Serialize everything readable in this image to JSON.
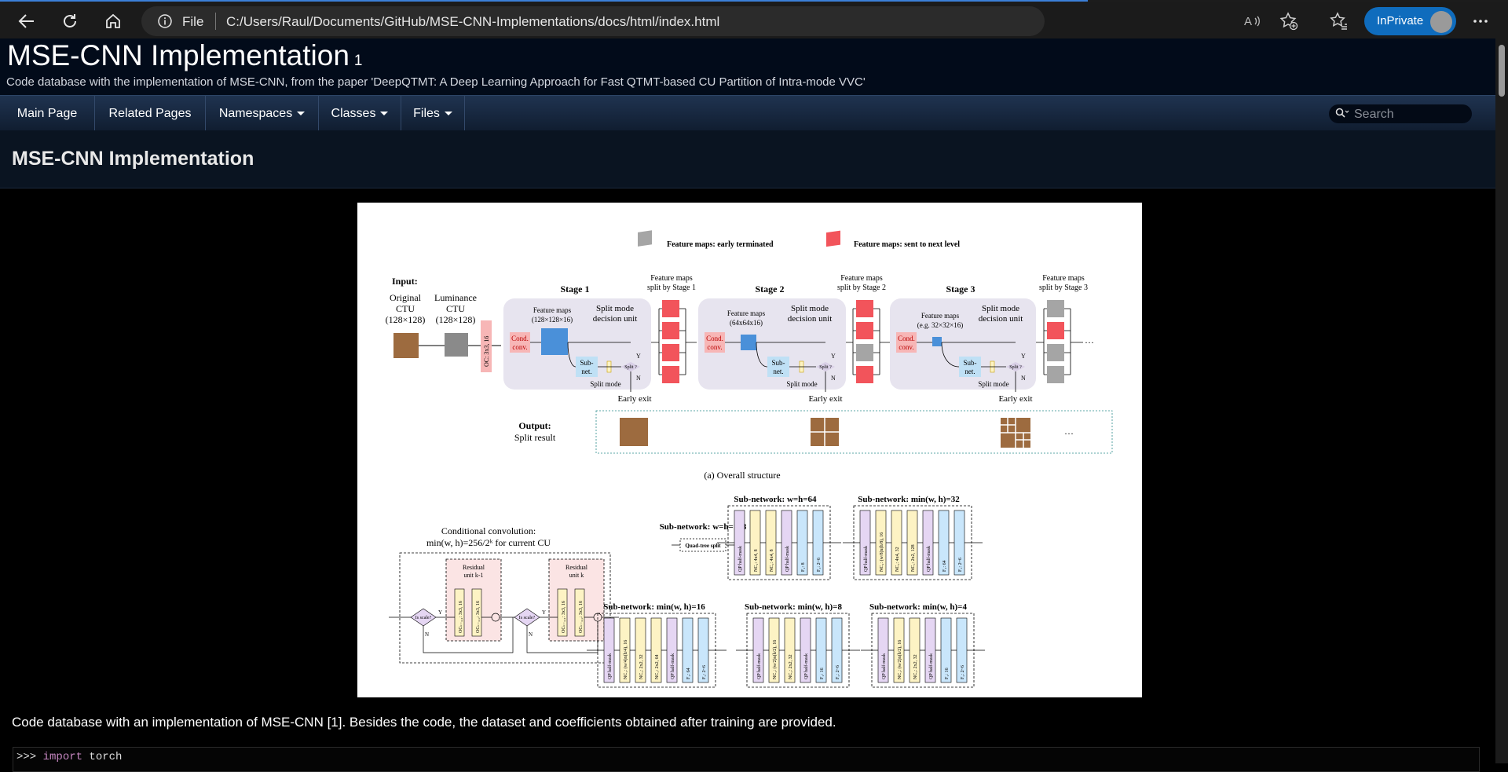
{
  "browser": {
    "file_label": "File",
    "url": "C:/Users/Raul/Documents/GitHub/MSE-CNN-Implementations/docs/html/index.html",
    "inprivate_label": "InPrivate"
  },
  "project": {
    "name": "MSE-CNN Implementation",
    "number": "1",
    "brief": "Code database with the implementation of MSE-CNN, from the paper 'DeepQTMT: A Deep Learning Approach for Fast QTMT-based CU Partition of Intra-mode VVC'"
  },
  "nav": {
    "items": [
      {
        "label": "Main Page"
      },
      {
        "label": "Related Pages"
      },
      {
        "label": "Namespaces"
      },
      {
        "label": "Classes"
      },
      {
        "label": "Files"
      }
    ],
    "search_placeholder": "Search"
  },
  "page": {
    "title": "MSE-CNN Implementation",
    "intro": "Code database with an implementation of MSE-CNN [1]. Besides the code, the dataset and coefficients obtained after training are provided.",
    "code_prompt": ">>> ",
    "code_keyword": "import",
    "code_rest": " torch"
  },
  "figure": {
    "legend_early": "Feature maps: early terminated",
    "legend_next": "Feature maps: sent to next level",
    "input_label": "Input:",
    "orig_ctu": [
      "Original",
      "CTU",
      "(128×128)"
    ],
    "lum_ctu": [
      "Luminance",
      "CTU",
      "(128×128)"
    ],
    "oc_label": "OC: 3x3, 16",
    "stage1": "Stage 1",
    "stage2": "Stage 2",
    "stage3": "Stage 3",
    "fmaps1": [
      "Feature maps",
      "(128×128×16)"
    ],
    "fmaps2": [
      "Feature maps",
      "(64x64x16)"
    ],
    "fmaps3": [
      "Feature maps",
      "(e.g. 32×32×16)"
    ],
    "split_unit": [
      "Split mode",
      "decision unit"
    ],
    "split_by1": [
      "Feature maps",
      "split by Stage 1"
    ],
    "split_by2": [
      "Feature maps",
      "split by Stage 2"
    ],
    "split_by3": [
      "Feature maps",
      "split by Stage 3"
    ],
    "cond_conv": [
      "Cond.",
      "conv."
    ],
    "subnet": [
      "Sub-",
      "net."
    ],
    "split_q": "Split ?",
    "split_mode": "Split mode",
    "early_exit": "Early exit",
    "y": "Y",
    "n": "N",
    "ellipsis": "···",
    "output_label": "Output:",
    "split_result": "Split result",
    "caption": "(a)  Overall structure",
    "condconv_title": "Conditional convolution:",
    "condconv_sub": "min(w, h)=256/2ᵏ for current CU",
    "residual_a": [
      "Residual",
      "unit k-1"
    ],
    "residual_b": [
      "Residual",
      "unit k"
    ],
    "is_scale": "Is scale?",
    "oc_k1": "OCₖ₋₁,₁: 3x3, 16",
    "oc_k2": "OCₖ₋₁,₂: 3x3, 16",
    "sn128_title": "Sub-network: w=h=128",
    "quad_tree": "Quad-tree split",
    "sn64_title": "Sub-network: w=h=64",
    "sn32_title": "Sub-network: min(w, h)=32",
    "sn16_title": "Sub-network: min(w, h)=16",
    "sn8_title": "Sub-network: min(w, h)=8",
    "sn4_title": "Sub-network: min(w, h)=4",
    "sn64_layers": [
      "QP half-mask",
      "NC₁: 4x4, 8",
      "NC₂: 4x4, 8",
      "QP half-mask",
      "F₁: 8",
      "F₂: 2~6"
    ],
    "sn32_layers": [
      "QP half-mask",
      "NC₁: (w/8)x(h/8), 16",
      "NC₂: 4x4, 32",
      "NC₃: 2x2, 128",
      "QP half-mask",
      "F₁: 64",
      "F₂: 2~6"
    ],
    "sn16_layers": [
      "QP half-mask",
      "NC₁: (w/4)x(h/4), 16",
      "NC₂: 2x2, 32",
      "NC₃: 2x2, 64",
      "QP half-mask",
      "F₁: 64",
      "F₂: 2~6"
    ],
    "sn8_layers": [
      "QP half-mask",
      "NC₁: (w/2)x(h/2), 16",
      "NC₂: 2x2, 32",
      "QP half-mask",
      "F₁: 16",
      "F₂: 2~6"
    ],
    "sn4_layers": [
      "QP half-mask",
      "NC₁: (w/2)x(h/2), 16",
      "NC₂: 2x2, 32",
      "QP half-mask",
      "F₁: 16",
      "F₂: 2~6"
    ],
    "colors": {
      "pink": "#f7b6b6",
      "stage_bg": "#e7e4ef",
      "blue_cube": "#4a90d9",
      "red_cube": "#f2545b",
      "gray_cube": "#a5a5a5",
      "light_blue": "#bfe0f5",
      "purple_layer": "#e5d6f3",
      "yellow_layer": "#fdf3c4",
      "blue_layer": "#c9e6fb",
      "wood": "#9d6b3f"
    }
  }
}
